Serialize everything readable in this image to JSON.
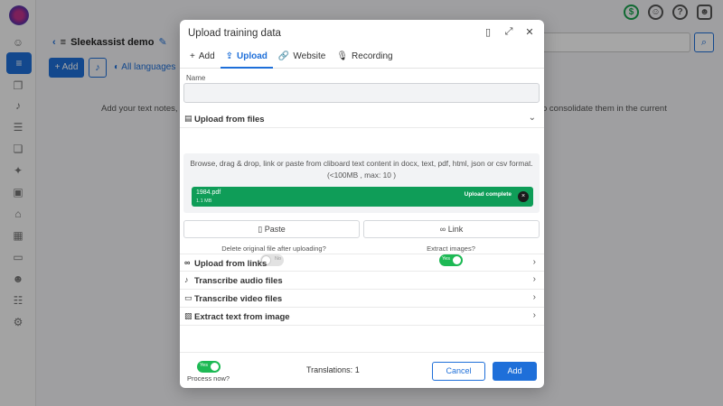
{
  "app": {
    "project_title": "Sleekassist demo",
    "add_label": "Add",
    "all_languages": "All languages",
    "bg_text_left": "Add your text notes, P",
    "bg_text_right": "o consolidate them in the current"
  },
  "modal": {
    "title": "Upload training data",
    "tabs": [
      {
        "icon": "+",
        "label": "Add"
      },
      {
        "icon": "⇪",
        "label": "Upload"
      },
      {
        "icon": "🔗",
        "label": "Website"
      },
      {
        "icon": "🎙",
        "label": "Recording"
      }
    ],
    "active_tab": "Upload",
    "name_label": "Name",
    "name_value": "",
    "upload_files_label": "Upload from files",
    "hint_line1": "Browse, drag & drop, link or paste from cliboard text content in docx, text, pdf, html, json or csv format.",
    "hint_line2": "(<100MB , max: 10 )",
    "file": {
      "name": "1984.pdf",
      "size": "1.1 MB",
      "status": "Upload complete",
      "remove": "×"
    },
    "paste_label": "Paste",
    "link_label": "Link",
    "delete_label": "Delete original file after uploading?",
    "delete_toggle": "No",
    "extract_label": "Extract images?",
    "extract_toggle": "Yes",
    "sections": [
      {
        "label": "Upload from links",
        "icon": "🔗"
      },
      {
        "label": "Transcribe audio files",
        "icon": "🎙"
      },
      {
        "label": "Transcribe video files",
        "icon": "▭"
      },
      {
        "label": "Extract text from image",
        "icon": "▨"
      }
    ],
    "footer": {
      "process_toggle": "Yes",
      "process_label": "Process now?",
      "translations": "Translations: 1",
      "cancel_label": "Cancel",
      "add_label": "Add"
    }
  },
  "colors": {
    "primary": "#1e6fd9",
    "success": "#0f9d58",
    "toggle_on": "#1db954"
  }
}
